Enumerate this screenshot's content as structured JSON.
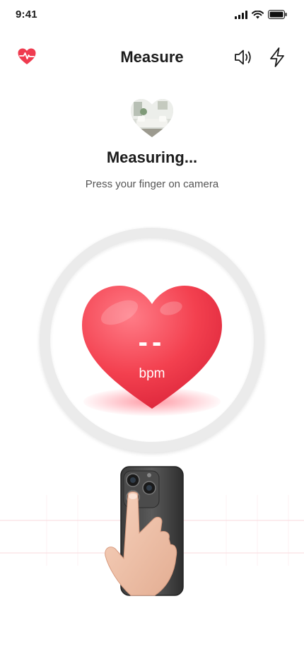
{
  "status_bar": {
    "time": "9:41",
    "icons": [
      "signal-icon",
      "wifi-icon",
      "battery-icon"
    ]
  },
  "nav": {
    "title": "Measure",
    "left_icon": "heart-pulse-icon",
    "right_icons": [
      "speaker-icon",
      "flash-icon"
    ]
  },
  "measure": {
    "headline": "Measuring...",
    "instruction": "Press your finger on camera",
    "value": "--",
    "unit": "bpm"
  },
  "colors": {
    "accent": "#ef3b4f",
    "heart_light": "#ff6b78",
    "heart_dark": "#e62d43",
    "ring": "#ebebeb",
    "grid": "#f6c9cf"
  }
}
